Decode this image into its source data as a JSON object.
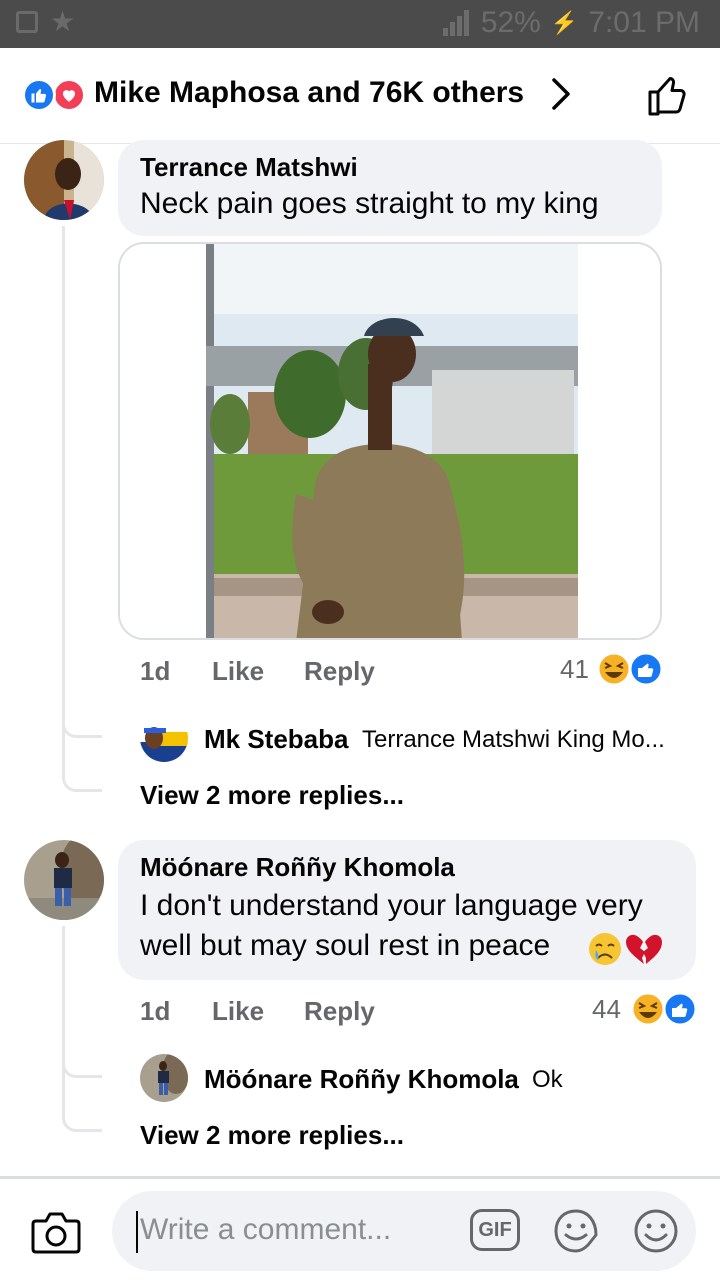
{
  "status_bar": {
    "battery": "52%",
    "time": "7:01 PM"
  },
  "header": {
    "reactions_text": "Mike Maphosa and 76K others"
  },
  "comments": [
    {
      "author": "Terrance Matshwi",
      "text": "Neck pain goes straight to my king",
      "time": "1d",
      "like_label": "Like",
      "reply_label": "Reply",
      "reaction_count": "41",
      "reply_preview": {
        "author": "Mk Stebaba",
        "text": "Terrance Matshwi King Mo..."
      },
      "view_more": "View 2 more replies..."
    },
    {
      "author": "Möónare Roññy Khomola",
      "text_line1": "I don't understand your language very",
      "text_line2": "well but may soul rest in peace",
      "time": "1d",
      "like_label": "Like",
      "reply_label": "Reply",
      "reaction_count": "44",
      "reply_preview": {
        "author": "Möónare Roññy Khomola",
        "text": "Ok"
      },
      "view_more": "View 2 more replies..."
    }
  ],
  "composer": {
    "placeholder": "Write a comment...",
    "gif_label": "GIF"
  },
  "colors": {
    "fb_blue": "#1877f2",
    "love_red": "#f33e58",
    "bubble": "#f0f2f5",
    "meta_gray": "#65676b"
  }
}
